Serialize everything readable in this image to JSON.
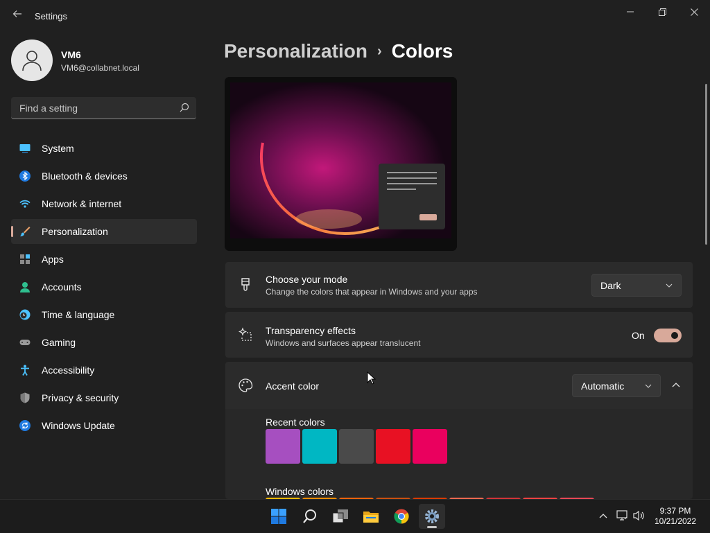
{
  "window": {
    "title": "Settings"
  },
  "user": {
    "name": "VM6",
    "email": "VM6@collabnet.local"
  },
  "search": {
    "placeholder": "Find a setting"
  },
  "nav": {
    "items": [
      {
        "label": "System",
        "icon": "system-icon"
      },
      {
        "label": "Bluetooth & devices",
        "icon": "bluetooth-icon"
      },
      {
        "label": "Network & internet",
        "icon": "wifi-icon"
      },
      {
        "label": "Personalization",
        "icon": "brush-icon",
        "selected": true
      },
      {
        "label": "Apps",
        "icon": "apps-icon"
      },
      {
        "label": "Accounts",
        "icon": "person-icon"
      },
      {
        "label": "Time & language",
        "icon": "clock-globe-icon"
      },
      {
        "label": "Gaming",
        "icon": "gamepad-icon"
      },
      {
        "label": "Accessibility",
        "icon": "accessibility-icon"
      },
      {
        "label": "Privacy & security",
        "icon": "shield-icon"
      },
      {
        "label": "Windows Update",
        "icon": "update-icon"
      }
    ]
  },
  "breadcrumb": {
    "parent": "Personalization",
    "separator": "›",
    "current": "Colors"
  },
  "mode": {
    "title": "Choose your mode",
    "description": "Change the colors that appear in Windows and your apps",
    "value": "Dark"
  },
  "transparency": {
    "title": "Transparency effects",
    "description": "Windows and surfaces appear translucent",
    "state_label": "On",
    "enabled": true
  },
  "accent": {
    "title": "Accent color",
    "value": "Automatic",
    "expanded": true,
    "recent_label": "Recent colors",
    "recent_colors": [
      "#a64fc0",
      "#00b7c3",
      "#4a4a4a",
      "#e81123",
      "#ea005e"
    ],
    "windows_label": "Windows colors",
    "windows_colors": [
      "#ffb900",
      "#ff8c00",
      "#f7630c",
      "#ca5010",
      "#da3b01",
      "#ef6950",
      "#d13438",
      "#ff4343",
      "#e74856"
    ]
  },
  "taskbar": {
    "apps": [
      "windows-start-icon",
      "search-icon",
      "task-view-icon",
      "file-explorer-icon",
      "chrome-icon",
      "settings-icon"
    ],
    "time": "9:37 PM",
    "date": "10/21/2022"
  },
  "colors": {
    "accent": "#d8a99a",
    "background": "#202020",
    "card": "#2b2b2b"
  }
}
